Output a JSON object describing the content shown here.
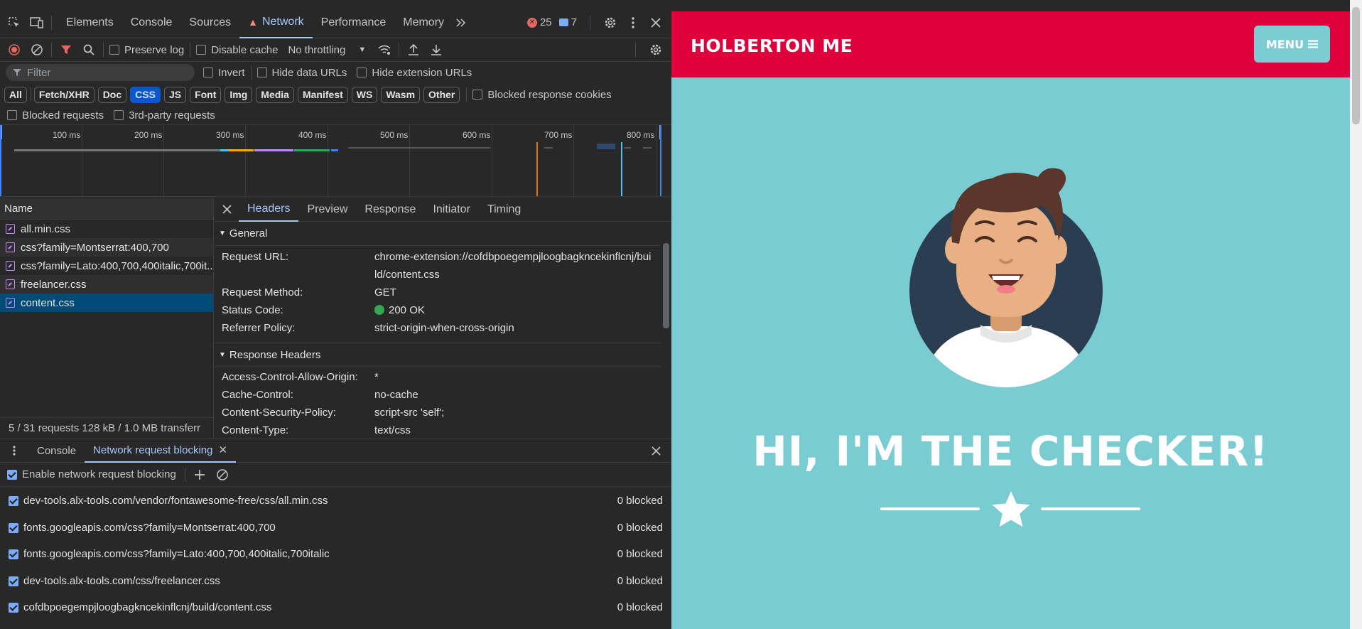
{
  "devtools": {
    "main_tabs": [
      "Elements",
      "Console",
      "Sources",
      "Network",
      "Performance",
      "Memory"
    ],
    "error_count": "25",
    "message_count": "7",
    "toolbar": {
      "preserve_log": "Preserve log",
      "disable_cache": "Disable cache",
      "throttling": "No throttling"
    },
    "filter": {
      "placeholder": "Filter",
      "invert": "Invert",
      "hide_data_urls": "Hide data URLs",
      "hide_extension_urls": "Hide extension URLs"
    },
    "type_filters": [
      "All",
      "Fetch/XHR",
      "Doc",
      "CSS",
      "JS",
      "Font",
      "Img",
      "Media",
      "Manifest",
      "WS",
      "Wasm",
      "Other"
    ],
    "active_type_filter": "CSS",
    "blocked_response_cookies": "Blocked response cookies",
    "blocked_requests": "Blocked requests",
    "third_party_requests": "3rd-party requests",
    "timeline_ticks": [
      "100 ms",
      "200 ms",
      "300 ms",
      "400 ms",
      "500 ms",
      "600 ms",
      "700 ms",
      "800 ms"
    ],
    "request_list": {
      "header": "Name",
      "rows": [
        "all.min.css",
        "css?family=Montserrat:400,700",
        "css?family=Lato:400,700,400italic,700it...",
        "freelancer.css",
        "content.css"
      ],
      "selected": "content.css",
      "footer": "5 / 31 requests    128 kB / 1.0 MB transferr"
    },
    "details": {
      "tabs": [
        "Headers",
        "Preview",
        "Response",
        "Initiator",
        "Timing"
      ],
      "general_title": "General",
      "general": [
        {
          "k": "Request URL:",
          "v": "chrome-extension://cofdbpoegempjloogbagkncekinflcnj/build/content.css"
        },
        {
          "k": "Request Method:",
          "v": "GET"
        },
        {
          "k": "Status Code:",
          "v": "200 OK"
        },
        {
          "k": "Referrer Policy:",
          "v": "strict-origin-when-cross-origin"
        }
      ],
      "response_title": "Response Headers",
      "response": [
        {
          "k": "Access-Control-Allow-Origin:",
          "v": "*"
        },
        {
          "k": "Cache-Control:",
          "v": "no-cache"
        },
        {
          "k": "Content-Security-Policy:",
          "v": "script-src 'self';"
        },
        {
          "k": "Content-Type:",
          "v": "text/css"
        }
      ]
    },
    "drawer": {
      "tabs": [
        "Console",
        "Network request blocking"
      ],
      "enable_label": "Enable network request blocking",
      "patterns": [
        {
          "pattern": "dev-tools.alx-tools.com/vendor/fontawesome-free/css/all.min.css",
          "count": "0 blocked"
        },
        {
          "pattern": "fonts.googleapis.com/css?family=Montserrat:400,700",
          "count": "0 blocked"
        },
        {
          "pattern": "fonts.googleapis.com/css?family=Lato:400,700,400italic,700italic",
          "count": "0 blocked"
        },
        {
          "pattern": "dev-tools.alx-tools.com/css/freelancer.css",
          "count": "0 blocked"
        },
        {
          "pattern": "cofdbpoegempjloogbagkncekinflcnj/build/content.css",
          "count": "0 blocked"
        }
      ]
    }
  },
  "page": {
    "brand": "HOLBERTON ME",
    "menu_label": "MENU",
    "hero_title": "HI, I'M THE CHECKER!"
  },
  "colors": {
    "navbar": "#e0003c",
    "masthead": "#78ccd2",
    "menu_button": "#7ccdd3",
    "accent": "#a8c7fa"
  }
}
